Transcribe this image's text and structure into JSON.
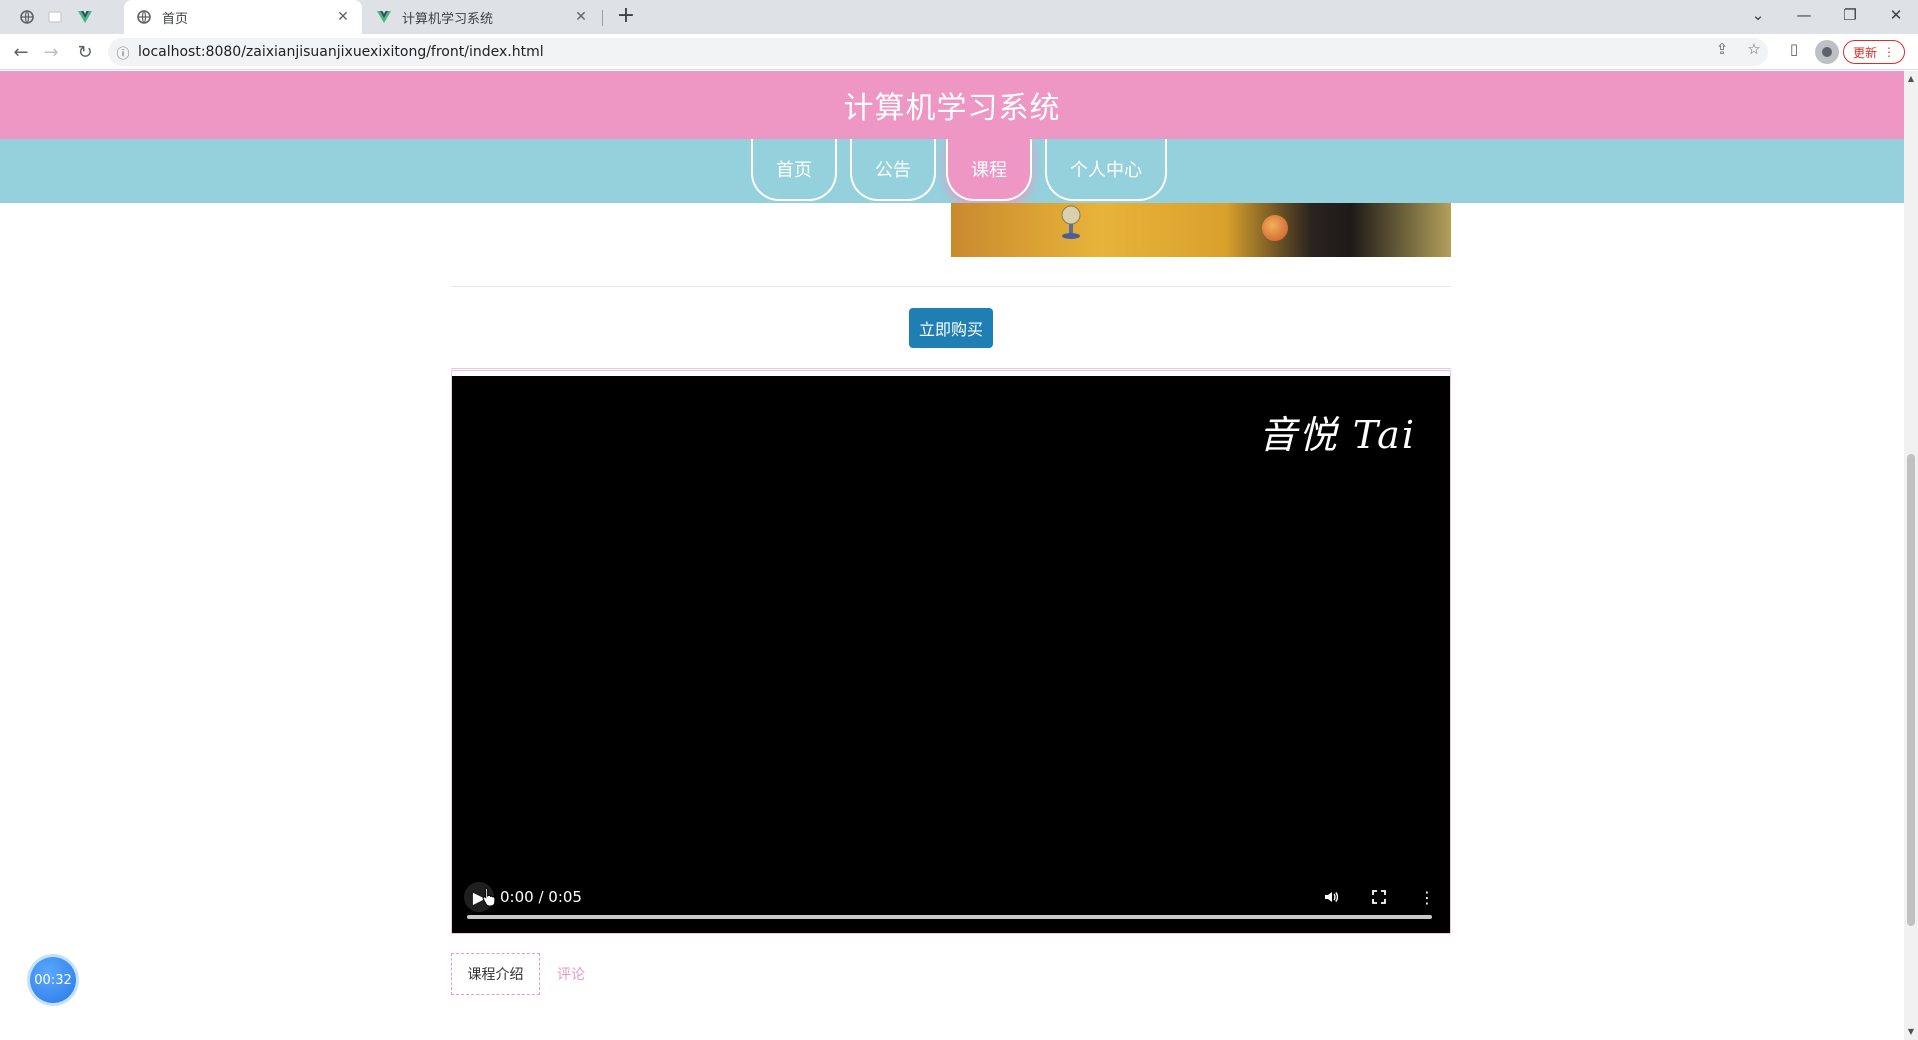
{
  "browser": {
    "tabs": [
      {
        "title": "首页",
        "active": true
      },
      {
        "title": "计算机学习系统",
        "active": false
      }
    ],
    "url": "localhost:8080/zaixianjisuanjixuexixitong/front/index.html",
    "update_label": "更新"
  },
  "site": {
    "title": "计算机学习系统",
    "nav": [
      {
        "label": "首页",
        "active": false
      },
      {
        "label": "公告",
        "active": false
      },
      {
        "label": "课程",
        "active": true
      },
      {
        "label": "个人中心",
        "active": false
      }
    ],
    "buy_label": "立即购买"
  },
  "video": {
    "watermark": "音悦 Tai",
    "time": "0:00 / 0:05",
    "progress": 0
  },
  "tabs": {
    "intro": "课程介绍",
    "comment": "评论"
  },
  "timer": "00:32",
  "colors": {
    "header_pink": "#ee96c4",
    "nav_teal": "#94d1dc",
    "buy_blue": "#1f7fb5"
  }
}
